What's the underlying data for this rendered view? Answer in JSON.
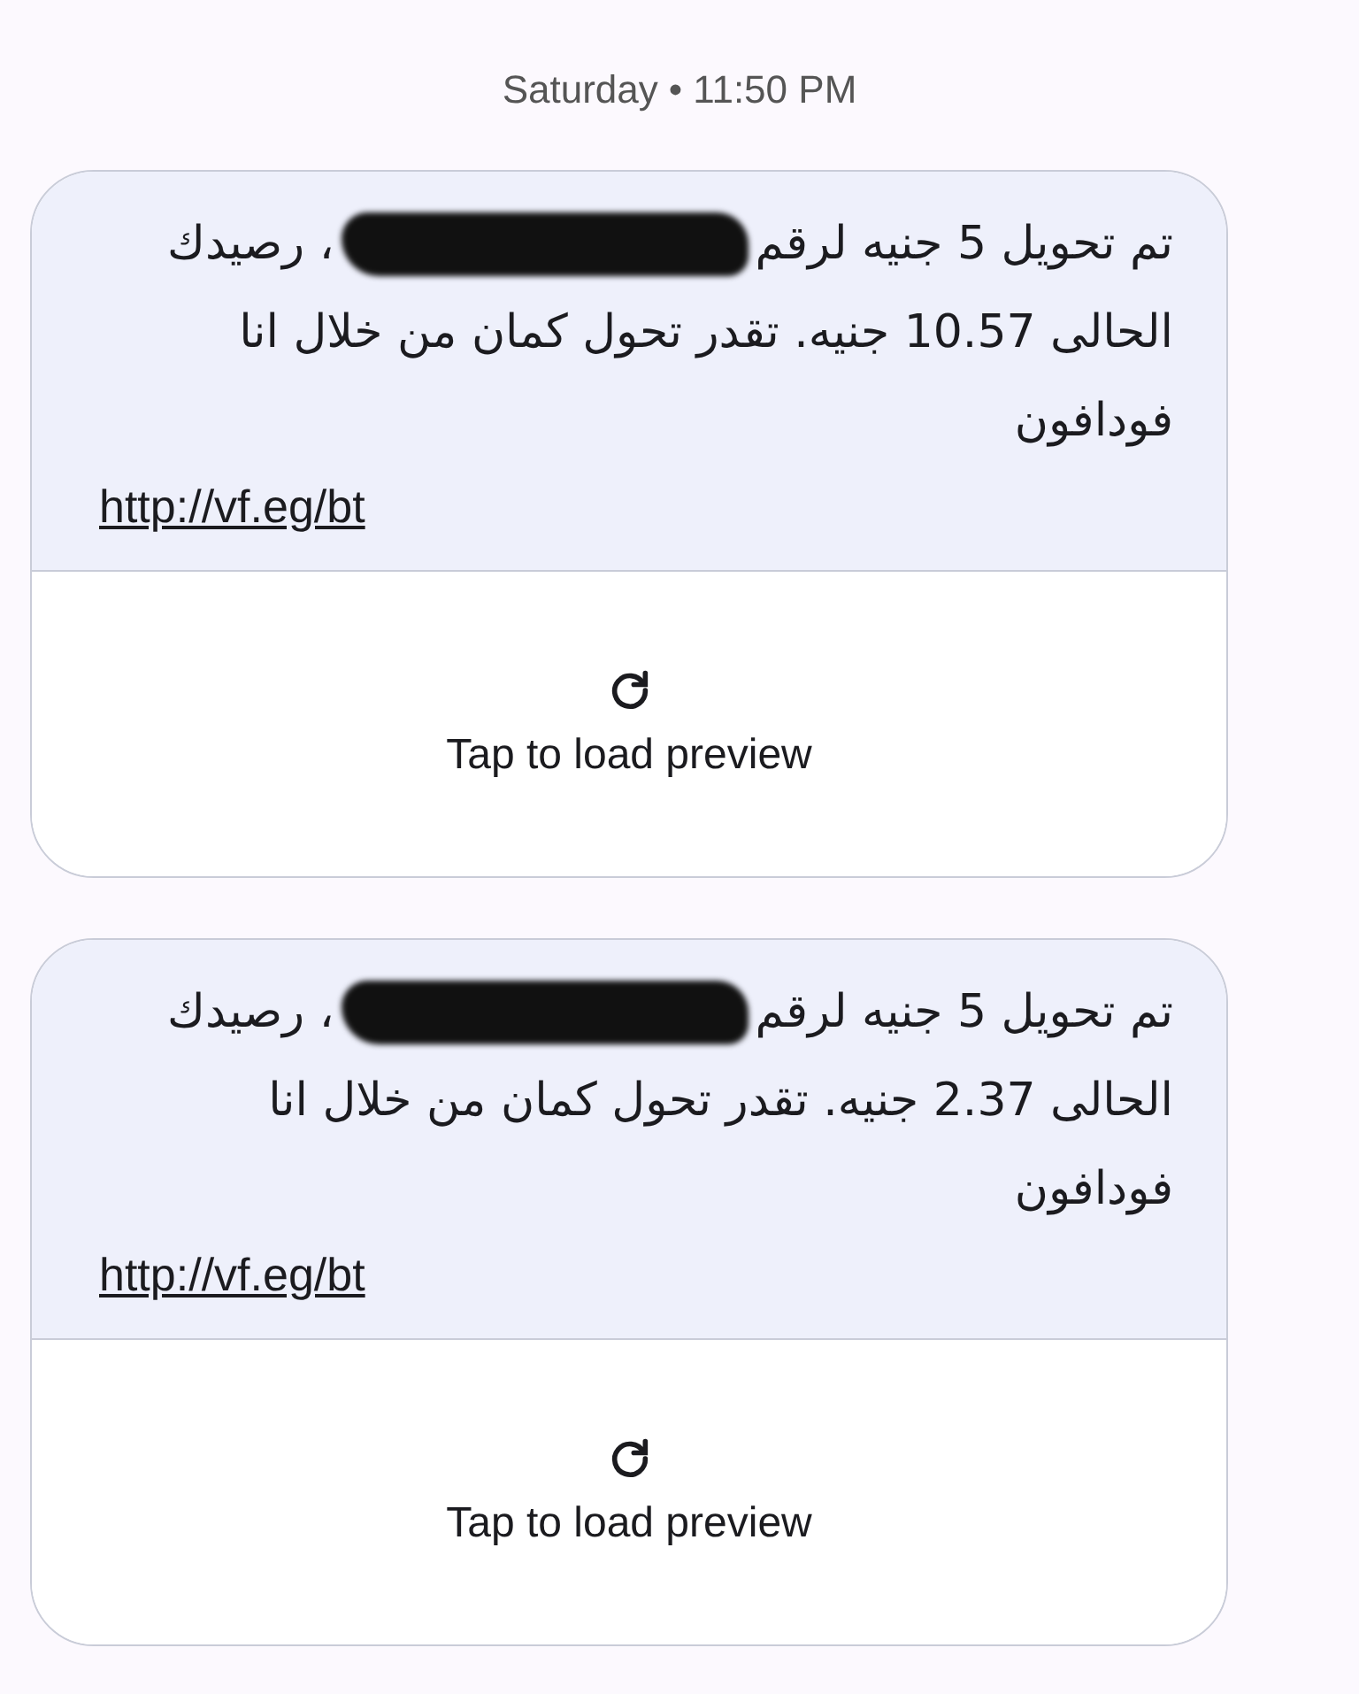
{
  "timestamp": {
    "day": "Saturday",
    "separator": "•",
    "time": "11:50 PM"
  },
  "messages": [
    {
      "text_before": "تم تحويل 5 جنيه لرقم",
      "redacted": true,
      "text_after": "، رصيدك",
      "text_rest": "الحالى 10.57 جنيه. تقدر تحول كمان من خلال انا فودافون",
      "link": "http://vf.eg/bt",
      "preview": {
        "label": "Tap to load preview"
      }
    },
    {
      "text_before": "تم تحويل 5 جنيه لرقم",
      "redacted": true,
      "text_after": "، رصيدك",
      "text_rest": "الحالى 2.37 جنيه. تقدر تحول كمان من خلال انا فودافون",
      "link": "http://vf.eg/bt",
      "preview": {
        "label": "Tap to load preview"
      }
    }
  ]
}
